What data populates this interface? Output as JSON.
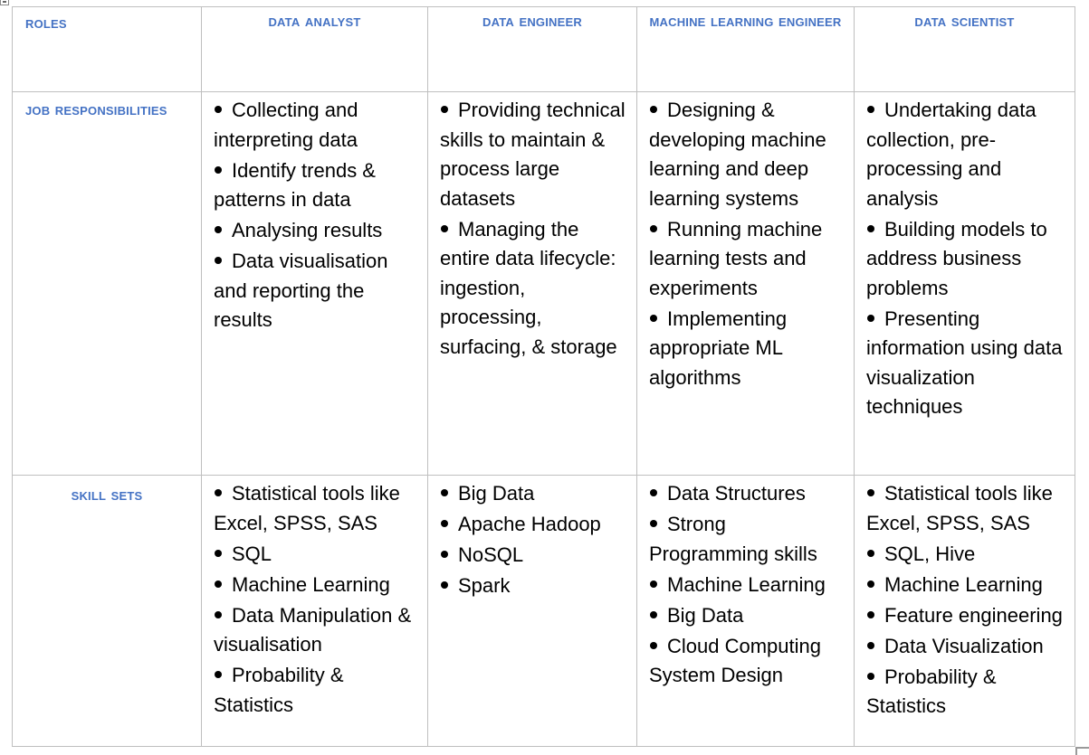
{
  "table": {
    "header": {
      "roles_label": "Roles",
      "columns": [
        "Data Analyst",
        "Data Engineer",
        "Machine Learning Engineer",
        "Data Scientist"
      ]
    },
    "rows": [
      {
        "label": "Job Responsibilities",
        "cells": [
          [
            "Collecting and interpreting data",
            "Identify trends & patterns in data",
            "Analysing results",
            "Data visualisation and reporting the results"
          ],
          [
            "Providing technical skills to maintain & process large datasets",
            "Managing the entire data lifecycle: ingestion, processing, surfacing, & storage"
          ],
          [
            "Designing & developing machine learning and deep learning systems",
            "Running machine learning tests and experiments",
            "Implementing appropriate ML algorithms"
          ],
          [
            "Undertaking data collection, pre-processing and analysis",
            "Building models to address business problems",
            "Presenting information using data visualization techniques"
          ]
        ]
      },
      {
        "label": "Skill sets",
        "cells": [
          [
            "Statistical tools like Excel, SPSS, SAS",
            "SQL",
            "Machine Learning",
            "Data Manipulation & visualisation",
            "Probability & Statistics"
          ],
          [
            "Big Data",
            "Apache Hadoop",
            "NoSQL",
            "Spark"
          ],
          [
            "Data Structures",
            "Strong Programming skills",
            "Machine Learning",
            "Big Data",
            "Cloud Computing System Design"
          ],
          [
            "Statistical tools like Excel, SPSS, SAS",
            "SQL, Hive",
            "Machine Learning",
            "Feature engineering",
            "Data Visualization",
            "Probability & Statistics"
          ]
        ]
      }
    ]
  },
  "colors": {
    "header_text": "#4472c4",
    "border": "#bfbfbf",
    "body_text": "#000000"
  }
}
